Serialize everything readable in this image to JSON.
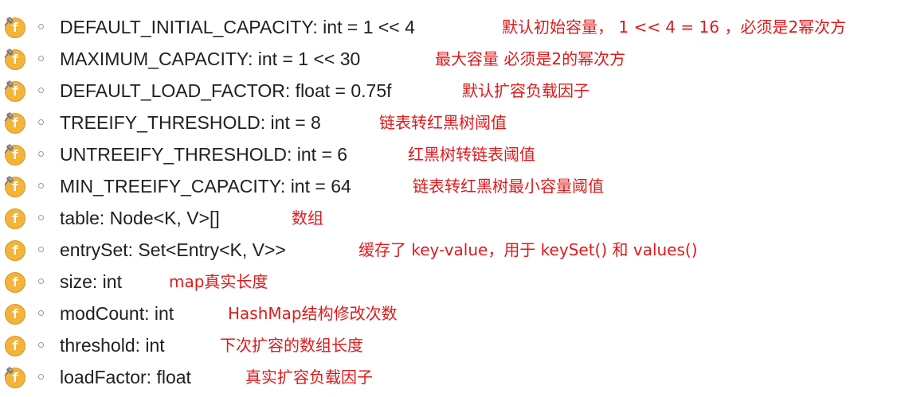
{
  "colors": {
    "icon_fill": "#f2b43a",
    "annotation": "#e0191b",
    "signature_text": "#202020",
    "visibility_marker": "#9a9a9a"
  },
  "icon_letter": "f",
  "fields": [
    {
      "signature": "DEFAULT_INITIAL_CAPACITY: int = 1 << 4",
      "note": "默认初始容量， 1 << 4 = 16 ，必须是2幂次方",
      "icon": "static-final-field-icon"
    },
    {
      "signature": "MAXIMUM_CAPACITY: int = 1 << 30",
      "note": "最大容量  必须是2的幂次方",
      "icon": "static-final-field-icon"
    },
    {
      "signature": "DEFAULT_LOAD_FACTOR: float = 0.75f",
      "note": "默认扩容负载因子",
      "icon": "static-final-field-icon"
    },
    {
      "signature": "TREEIFY_THRESHOLD: int = 8",
      "note": "链表转红黑树阈值",
      "icon": "static-final-field-icon"
    },
    {
      "signature": "UNTREEIFY_THRESHOLD: int = 6",
      "note": "红黑树转链表阈值",
      "icon": "static-final-field-icon"
    },
    {
      "signature": "MIN_TREEIFY_CAPACITY: int = 64",
      "note": "链表转红黑树最小容量阈值",
      "icon": "static-final-field-icon"
    },
    {
      "signature": "table: Node<K, V>[]",
      "note": "数组",
      "icon": "field-icon"
    },
    {
      "signature": "entrySet: Set<Entry<K, V>>",
      "note": "缓存了 key-value，用于 keySet() 和 values()",
      "icon": "field-icon"
    },
    {
      "signature": "size: int",
      "note": "map真实长度",
      "icon": "field-icon"
    },
    {
      "signature": "modCount: int",
      "note": "HashMap结构修改次数",
      "icon": "field-icon"
    },
    {
      "signature": "threshold: int",
      "note": "下次扩容的数组长度",
      "icon": "field-icon"
    },
    {
      "signature": "loadFactor: float",
      "note": "真实扩容负载因子",
      "icon": "static-final-field-icon"
    }
  ]
}
